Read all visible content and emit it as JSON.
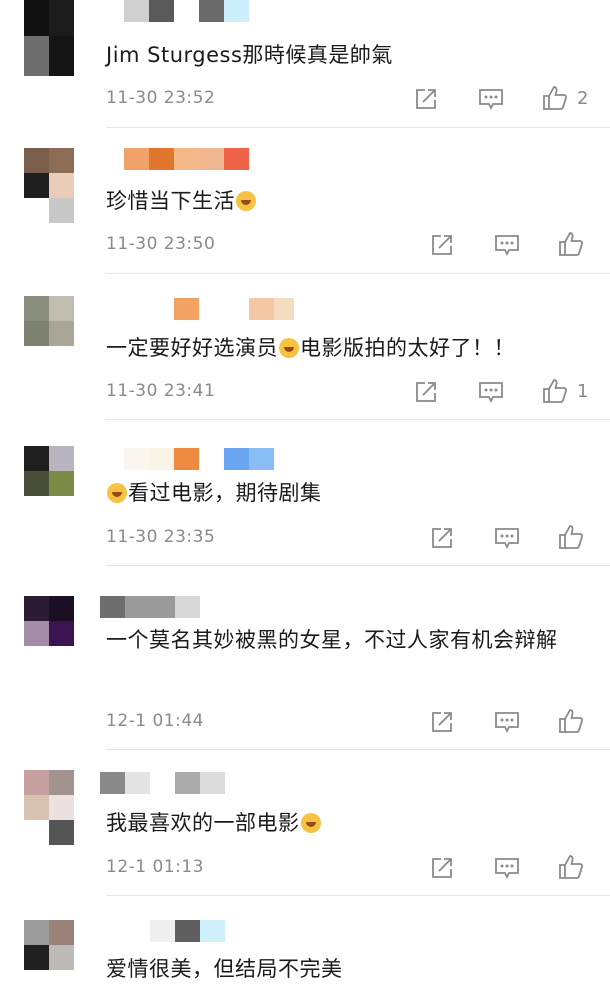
{
  "comments": [
    {
      "time": "11-30 23:52",
      "text": "Jim Sturgess那時候真是帥氣",
      "likes": "2",
      "has_emoji": false,
      "avatar_colors": [
        "#121212",
        "#1b1b1b",
        "#6e6e6e",
        "#151515"
      ],
      "name_colors": [
        "#d0d0d0",
        "#5a5a5a",
        "",
        "#6a6a6a",
        "#cdeefc"
      ]
    },
    {
      "time": "11-30 23:50",
      "text": "珍惜当下生活",
      "likes": "",
      "has_emoji": true,
      "emoji_after": "",
      "avatar_colors": [
        "#7a5e4c",
        "#8c6c55",
        "#1e1e1e",
        "#e9cdb8"
      ],
      "name_colors": [
        "#f0a26a",
        "#e2762f",
        "#f5b989",
        "#f0b790",
        "#f16348"
      ]
    },
    {
      "time": "11-30 23:41",
      "text": "一定要好好选演员",
      "text_after": "电影版拍的太好了！！",
      "likes": "1",
      "has_emoji": true,
      "avatar_colors": [
        "#8a8e7c",
        "#c0bcb2",
        "#7e8270",
        "#a9a697"
      ],
      "name_colors": [
        "#f2a261",
        "",
        "#f4c8a4",
        "#f3dcc0"
      ]
    },
    {
      "time": "11-30 23:35",
      "text": "看过电影，期待剧集",
      "likes": "",
      "has_emoji": true,
      "emoji_first": true,
      "avatar_colors": [
        "#1f1f1f",
        "#b9b5c0",
        "#4a4f3a",
        "#7b8a45"
      ],
      "name_colors": [
        "#fbf7ee",
        "#faf4e6",
        "#ee8a42",
        "",
        "#6aa6f2",
        "#88bdf6"
      ]
    },
    {
      "time": "12-1 01:44",
      "text": "一个莫名其妙被黑的女星，不过人家有机会辩解",
      "likes": "",
      "has_emoji": false,
      "avatar_colors": [
        "#2b1c33",
        "#1a0f23",
        "#a48ca6",
        "#3a1450"
      ],
      "name_colors": [
        "#6e6e6e",
        "#9a9a9a",
        "#d8d8d8"
      ]
    },
    {
      "time": "12-1 01:13",
      "text": "我最喜欢的一部电影",
      "likes": "",
      "has_emoji": true,
      "avatar_colors": [
        "#c7a0a0",
        "#a2938e",
        "#d9c3b0",
        "#ece2df"
      ],
      "name_colors": [
        "#8a8a8a",
        "#e4e4e4",
        "",
        "#ababab",
        "#dcdcdc"
      ]
    },
    {
      "time": "",
      "text": "爱情很美，但结局不完美",
      "likes": "",
      "has_emoji": false,
      "avatar_colors": [
        "#9c9c9c",
        "#9a8278",
        "#202020",
        "#bdbab8"
      ],
      "name_colors": [
        "#efefef",
        "#5f5f5f",
        "#cfeffc"
      ]
    }
  ]
}
